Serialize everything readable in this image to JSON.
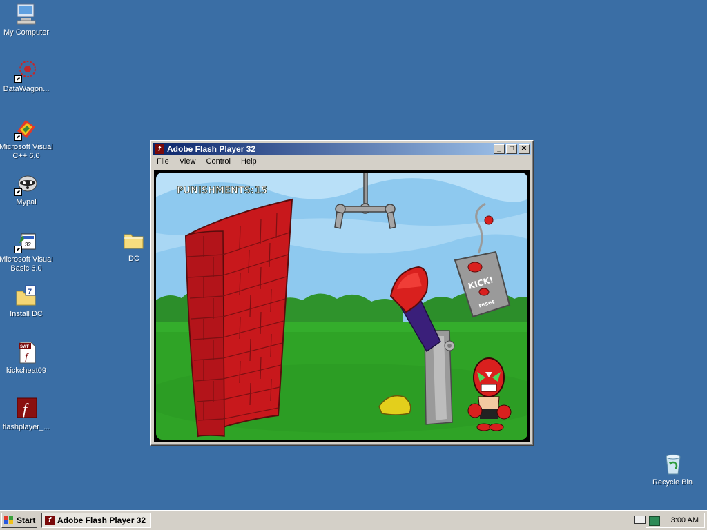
{
  "desktop": {
    "icons": [
      {
        "label": "My Computer",
        "icon": "computer-icon"
      },
      {
        "label": "DataWagon...",
        "icon": "datawagon-icon"
      },
      {
        "label": "Microsoft Visual C++ 6.0",
        "icon": "visual-cpp-icon"
      },
      {
        "label": "Mypal",
        "icon": "mypal-icon"
      },
      {
        "label": "Microsoft Visual Basic 6.0",
        "icon": "visual-basic-icon"
      },
      {
        "label": "Install DC",
        "icon": "install-icon"
      },
      {
        "label": "kickcheat09",
        "icon": "swf-file-icon"
      },
      {
        "label": "flashplayer_...",
        "icon": "flash-player-icon"
      },
      {
        "label": "DC",
        "icon": "folder-icon"
      },
      {
        "label": "Recycle Bin",
        "icon": "recycle-bin-icon"
      }
    ]
  },
  "window": {
    "title": "Adobe Flash Player 32",
    "icon": "flash-icon",
    "controls": {
      "minimize": "_",
      "maximize": "□",
      "close": "✕"
    },
    "menu": [
      "File",
      "View",
      "Control",
      "Help"
    ]
  },
  "game": {
    "score_label": "PUNISHMENTS:",
    "score_value": "15",
    "remote_kick_label": "KICK!",
    "remote_reset_label": "reset"
  },
  "taskbar": {
    "start_label": "Start",
    "task_label": "Adobe Flash Player 32",
    "clock": "3:00 AM"
  },
  "colors": {
    "desktop": "#3a6ea5",
    "titlebar_start": "#0a246a",
    "titlebar_end": "#a6caf0",
    "sky": "#8ec9ef",
    "grass": "#2fa326",
    "brick": "#c8181c"
  }
}
